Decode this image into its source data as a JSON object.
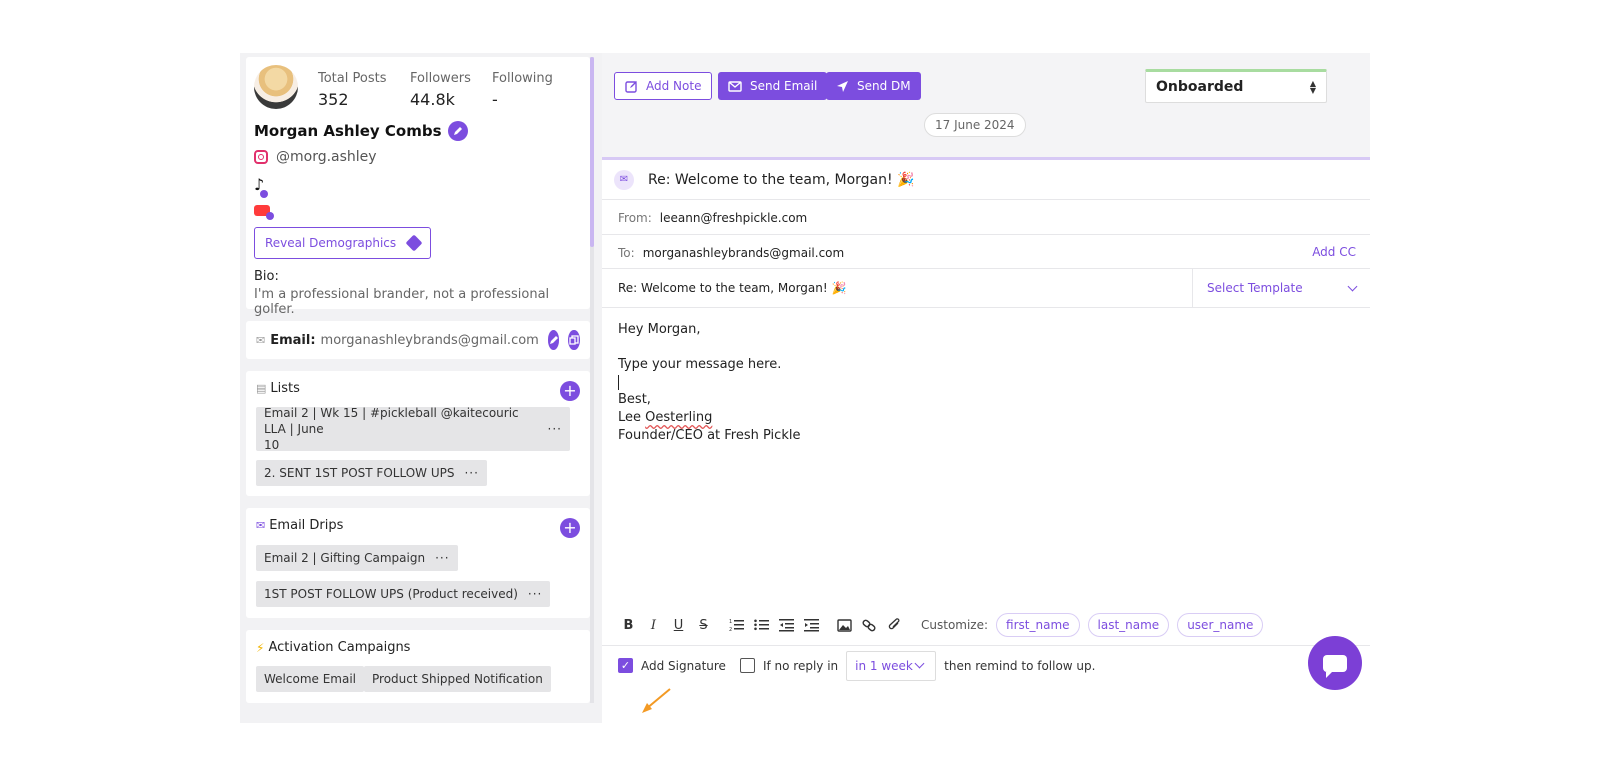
{
  "profile": {
    "stats": [
      {
        "label": "Total Posts",
        "value": "352"
      },
      {
        "label": "Followers",
        "value": "44.8k"
      },
      {
        "label": "Following",
        "value": "-"
      }
    ],
    "name": "Morgan Ashley Combs",
    "instagram": "@morg.ashley",
    "reveal_label": "Reveal Demographics",
    "bio_label": "Bio:",
    "bio_text": "I'm a professional brander, not a professional golfer."
  },
  "contact": {
    "email_label": "Email:",
    "email_value": "morganashleybrands@gmail.com"
  },
  "lists": {
    "title": "Lists",
    "items": [
      {
        "line1": "Email 2 | Wk 15 | #pickleball @kaitecouric LLA | June",
        "line2": "10"
      },
      {
        "line1": "2. SENT 1ST POST FOLLOW UPS",
        "line2": ""
      }
    ]
  },
  "drips": {
    "title": "Email Drips",
    "items": [
      "Email 2 | Gifting Campaign",
      "1ST POST FOLLOW UPS (Product received)"
    ]
  },
  "activation": {
    "title": "Activation Campaigns",
    "items": [
      "Welcome Email",
      "Product Shipped Notification"
    ]
  },
  "toolbar": {
    "add_note": "Add Note",
    "send_email": "Send Email",
    "send_dm": "Send DM",
    "status": "Onboarded"
  },
  "thread": {
    "date": "17 June 2024",
    "subject_header": "Re: Welcome to the team, Morgan! 🎉"
  },
  "compose": {
    "from_label": "From:",
    "from_value": "leeann@freshpickle.com",
    "to_label": "To:",
    "to_value": "morganashleybrands@gmail.com",
    "add_cc": "Add CC",
    "subject": "Re: Welcome to the team, Morgan! 🎉",
    "template_placeholder": "Select Template",
    "body": {
      "greeting": "Hey Morgan,",
      "message": "Type your message here.",
      "closing": "Best,",
      "sig_first": "Lee",
      "sig_last": "Oesterling",
      "sig_title": "Founder/CEO at Fresh Pickle"
    },
    "customize_label": "Customize:",
    "variables": [
      "first_name",
      "last_name",
      "user_name"
    ],
    "add_signature": "Add Signature",
    "no_reply_label": "If no reply in",
    "remind_period": "in 1 week",
    "remind_suffix": "then remind to follow up."
  },
  "colors": {
    "accent": "#7c4ddf",
    "status_bar": "#a8dca0"
  }
}
